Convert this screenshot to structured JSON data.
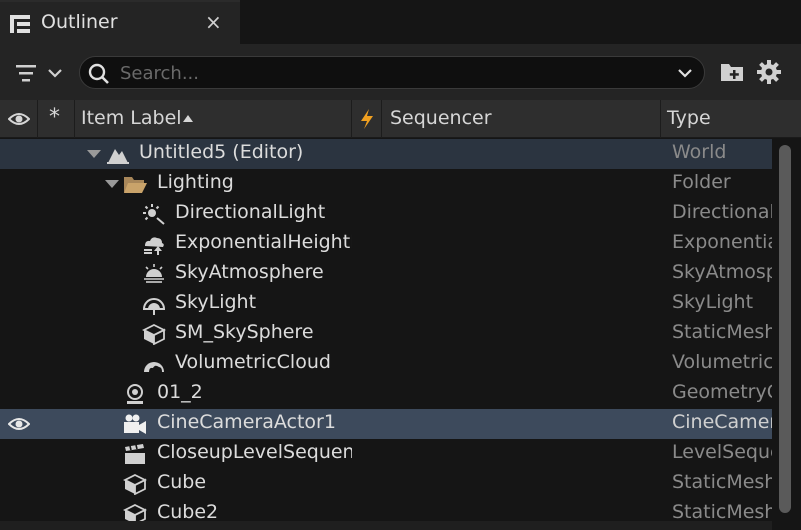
{
  "tab": {
    "title": "Outliner",
    "close": "×"
  },
  "search": {
    "placeholder": "Search..."
  },
  "columns": {
    "item_label": "Item Label",
    "sequencer": "Sequencer",
    "type": "Type"
  },
  "rows": [
    {
      "label": "Untitled5 (Editor)",
      "type": "World",
      "icon": "world-icon"
    },
    {
      "label": "Lighting",
      "type": "Folder",
      "icon": "folder-open-icon"
    },
    {
      "label": "DirectionalLight",
      "type": "DirectionalLight",
      "icon": "directional-light-icon"
    },
    {
      "label": "ExponentialHeightFog",
      "type": "ExponentialHeightFog",
      "icon": "height-fog-icon"
    },
    {
      "label": "SkyAtmosphere",
      "type": "SkyAtmosphere",
      "icon": "sky-atmosphere-icon"
    },
    {
      "label": "SkyLight",
      "type": "SkyLight",
      "icon": "sky-light-icon"
    },
    {
      "label": "SM_SkySphere",
      "type": "StaticMeshActor",
      "icon": "static-mesh-icon"
    },
    {
      "label": "VolumetricCloud",
      "type": "VolumetricCloud",
      "icon": "volumetric-cloud-icon"
    },
    {
      "label": "01_2",
      "type": "GeometryCollectionActor",
      "icon": "geometry-collection-icon"
    },
    {
      "label": "CineCameraActor1",
      "type": "CineCameraActor",
      "icon": "cine-camera-icon"
    },
    {
      "label": "CloseupLevelSequence",
      "type": "LevelSequenceActor",
      "icon": "level-sequence-icon"
    },
    {
      "label": "Cube",
      "type": "StaticMeshActor",
      "icon": "static-mesh-icon"
    },
    {
      "label": "Cube2",
      "type": "StaticMeshActor",
      "icon": "static-mesh-icon"
    }
  ],
  "colors": {
    "selection": "#3d4a5c",
    "accent": "#f0a020",
    "folder": "#c9a36a"
  }
}
